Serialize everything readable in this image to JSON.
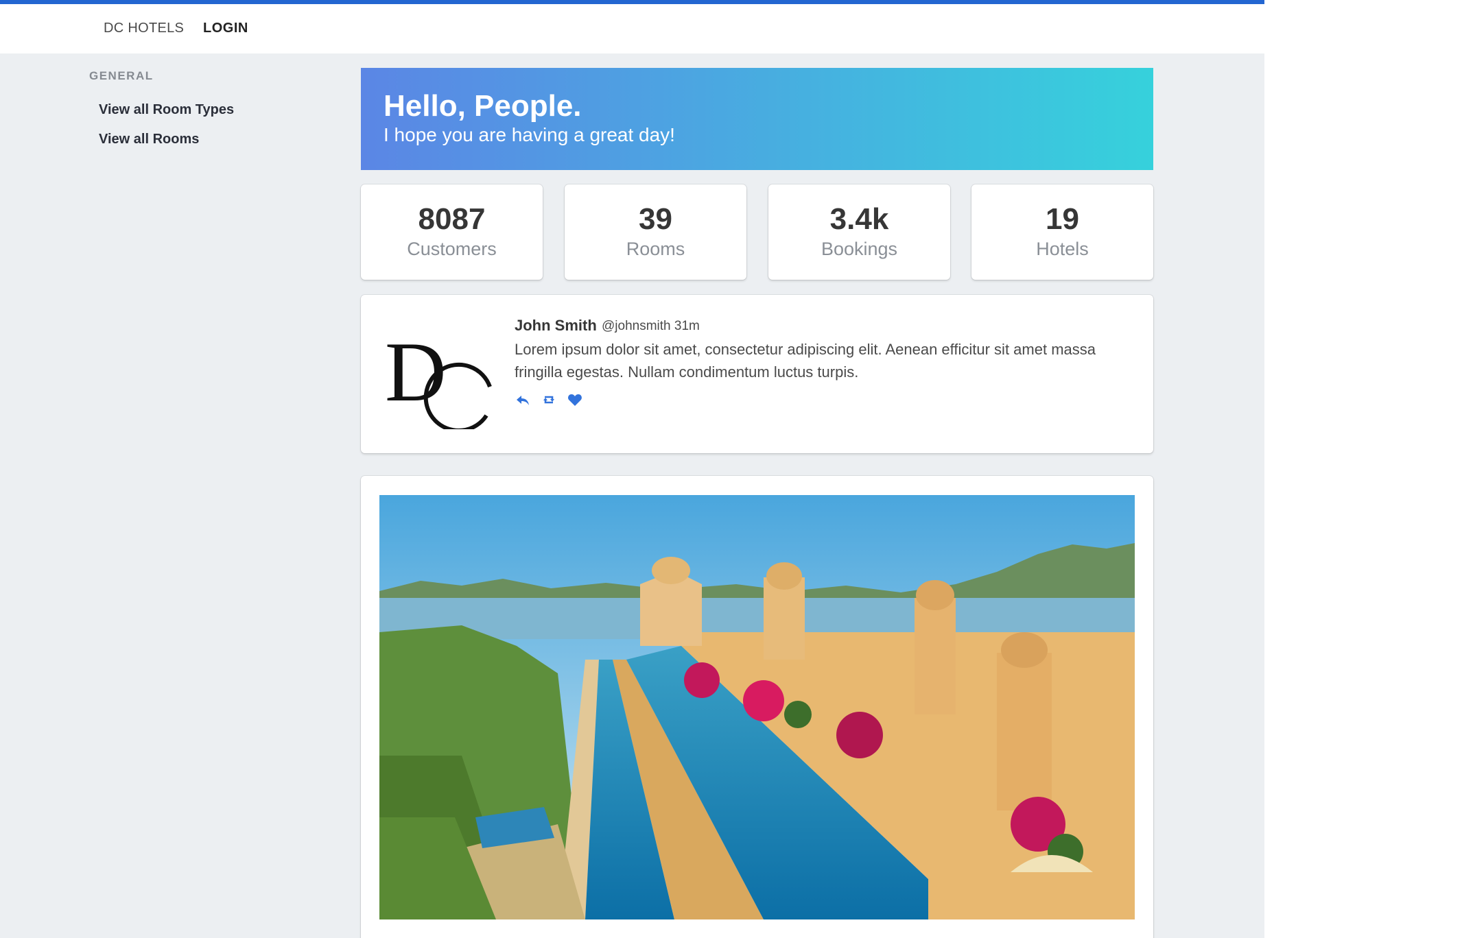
{
  "nav": {
    "brand": "DC HOTELS",
    "login": "LOGIN"
  },
  "sidebar": {
    "heading": "GENERAL",
    "items": [
      {
        "label": "View all Room Types"
      },
      {
        "label": "View all Rooms"
      }
    ]
  },
  "hero": {
    "title": "Hello, People.",
    "subtitle": "I hope you are having a great day!"
  },
  "stats": [
    {
      "value": "8087",
      "label": "Customers"
    },
    {
      "value": "39",
      "label": "Rooms"
    },
    {
      "value": "3.4k",
      "label": "Bookings"
    },
    {
      "value": "19",
      "label": "Hotels"
    }
  ],
  "post": {
    "logo_text": "DC",
    "author": "John Smith",
    "meta": "@johnsmith 31m",
    "text": "Lorem ipsum dolor sit amet, consectetur adipiscing elit. Aenean efficitur sit amet massa fringilla egestas. Nullam condimentum luctus turpis.",
    "actions": [
      "reply-icon",
      "retweet-icon",
      "heart-icon"
    ]
  },
  "colors": {
    "accent": "#2366d1",
    "hero_start": "#5b86e5",
    "hero_end": "#36d1dc",
    "background": "#eceff2"
  }
}
